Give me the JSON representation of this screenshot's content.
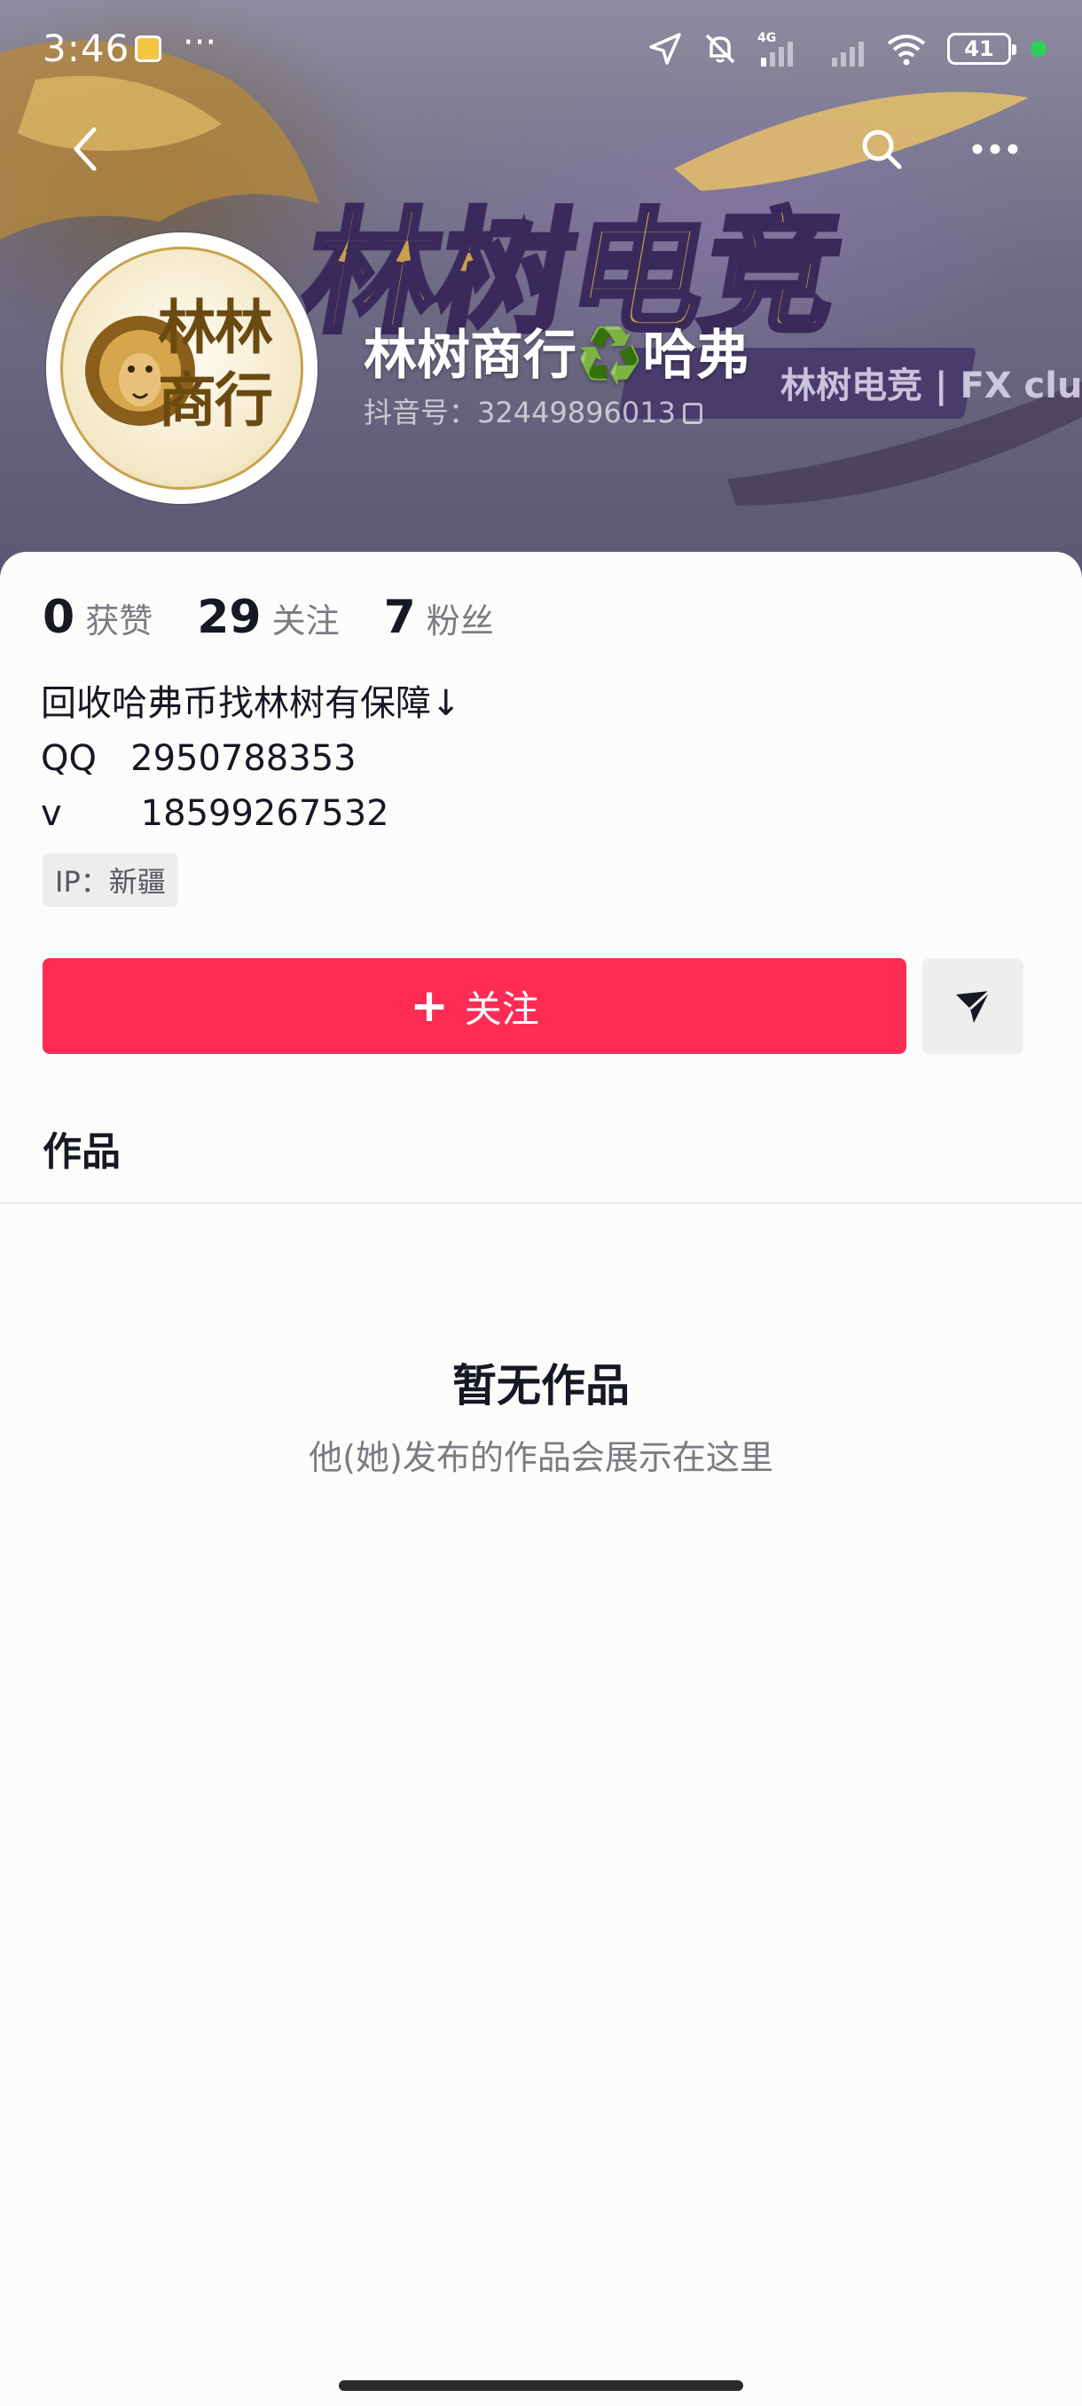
{
  "status_bar": {
    "time": "3:46",
    "dots": "···",
    "network": "4G",
    "battery": "41"
  },
  "profile": {
    "display_name": "林树商行♻️哈弗",
    "handle": "抖音号：32449896013",
    "avatar_text": "林林商行",
    "banner_text": "林树电竞",
    "banner_sub": "林树电竞 | FX club"
  },
  "stats": [
    {
      "value": "0",
      "label": "获赞"
    },
    {
      "value": "29",
      "label": "关注"
    },
    {
      "value": "7",
      "label": "粉丝"
    }
  ],
  "bio": {
    "line1": "回收哈弗币找林树有保障↓",
    "line2": "QQ   2950788353",
    "line3": "v       18599267532"
  },
  "ip_tag": "IP：新疆",
  "actions": {
    "follow_label": "关注",
    "follow_plus": "+"
  },
  "tabs": {
    "works": "作品"
  },
  "empty_state": {
    "title": "暂无作品",
    "subtitle": "他(她)发布的作品会展示在这里"
  },
  "colors": {
    "accent": "#FE2C55",
    "text_primary": "#161823",
    "text_secondary": "#7A7B83"
  }
}
